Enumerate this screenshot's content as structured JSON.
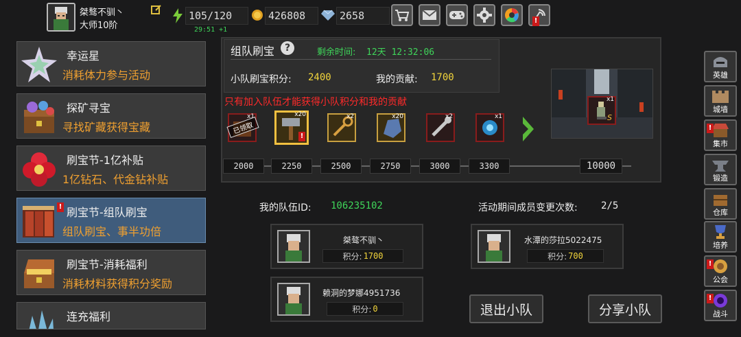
{
  "player": {
    "name": "桀骜不驯丶",
    "rank": "大师10阶"
  },
  "stats": {
    "stamina": "105/120",
    "timer": "29:51 +1",
    "gold": "426808",
    "diamond": "2658"
  },
  "top_icons": [
    "cart-icon",
    "mail-icon",
    "gamepad-icon",
    "gear-icon",
    "camera-icon",
    "broadcast-icon"
  ],
  "sidebar": {
    "items": [
      {
        "title": "幸运星",
        "sub": "消耗体力参与活动"
      },
      {
        "title": "探矿寻宝",
        "sub": "寻找矿藏获得宝藏"
      },
      {
        "title": "刷宝节-1亿补贴",
        "sub": "1亿钻石、代金钻补贴"
      },
      {
        "title": "刷宝节-组队刷宝",
        "sub": "组队刷宝、事半功倍"
      },
      {
        "title": "刷宝节-消耗福利",
        "sub": "消耗材料获得积分奖励"
      },
      {
        "title": "连充福利",
        "sub": ""
      }
    ]
  },
  "event": {
    "title": "组队刷宝",
    "help": "?",
    "remaining_label": "剩余时间:",
    "remaining_value": "12天 12:32:06",
    "team_score_label": "小队刷宝积分:",
    "team_score_value": "2400",
    "my_contrib_label": "我的贡献:",
    "my_contrib_value": "1700",
    "warning": "只有加入队伍才能获得小队积分和我的贡献",
    "claimed": "已领取",
    "rewards": [
      {
        "qty": "x1"
      },
      {
        "qty": "x20"
      },
      {
        "qty": "x2"
      },
      {
        "qty": "x20"
      },
      {
        "qty": "x2"
      },
      {
        "qty": "x1"
      }
    ],
    "milestones": [
      "2000",
      "2250",
      "2500",
      "2750",
      "3000",
      "3300",
      "10000"
    ],
    "grand_reward": {
      "qty": "x1",
      "grade": "S"
    }
  },
  "team": {
    "id_label": "我的队伍ID:",
    "id_value": "106235102",
    "changes_label": "活动期间成员变更次数:",
    "changes_value": "2/5",
    "score_prefix": "积分:",
    "members": [
      {
        "name": "桀骜不驯丶",
        "score": "1700"
      },
      {
        "name": "水潭的莎拉5022475",
        "score": "700"
      },
      {
        "name": "赖洞的梦娜4951736",
        "score": "0"
      }
    ],
    "leave_button": "退出小队",
    "share_button": "分享小队"
  },
  "right_nav": [
    {
      "label": "英雄",
      "icon": "helmet-icon",
      "alert": false
    },
    {
      "label": "城墙",
      "icon": "wall-icon",
      "alert": false
    },
    {
      "label": "集市",
      "icon": "market-icon",
      "alert": true
    },
    {
      "label": "锻造",
      "icon": "anvil-icon",
      "alert": false
    },
    {
      "label": "仓库",
      "icon": "warehouse-icon",
      "alert": false
    },
    {
      "label": "培养",
      "icon": "trophy-icon",
      "alert": false
    },
    {
      "label": "公会",
      "icon": "guild-icon",
      "alert": true
    },
    {
      "label": "战斗",
      "icon": "portal-icon",
      "alert": true
    }
  ],
  "colors": {
    "accent_green": "#3fd65a",
    "accent_orange": "#f0a030",
    "accent_yellow": "#f2d53c",
    "warning_red": "#ff2a2a",
    "active_tab": "#3f5c7c"
  }
}
